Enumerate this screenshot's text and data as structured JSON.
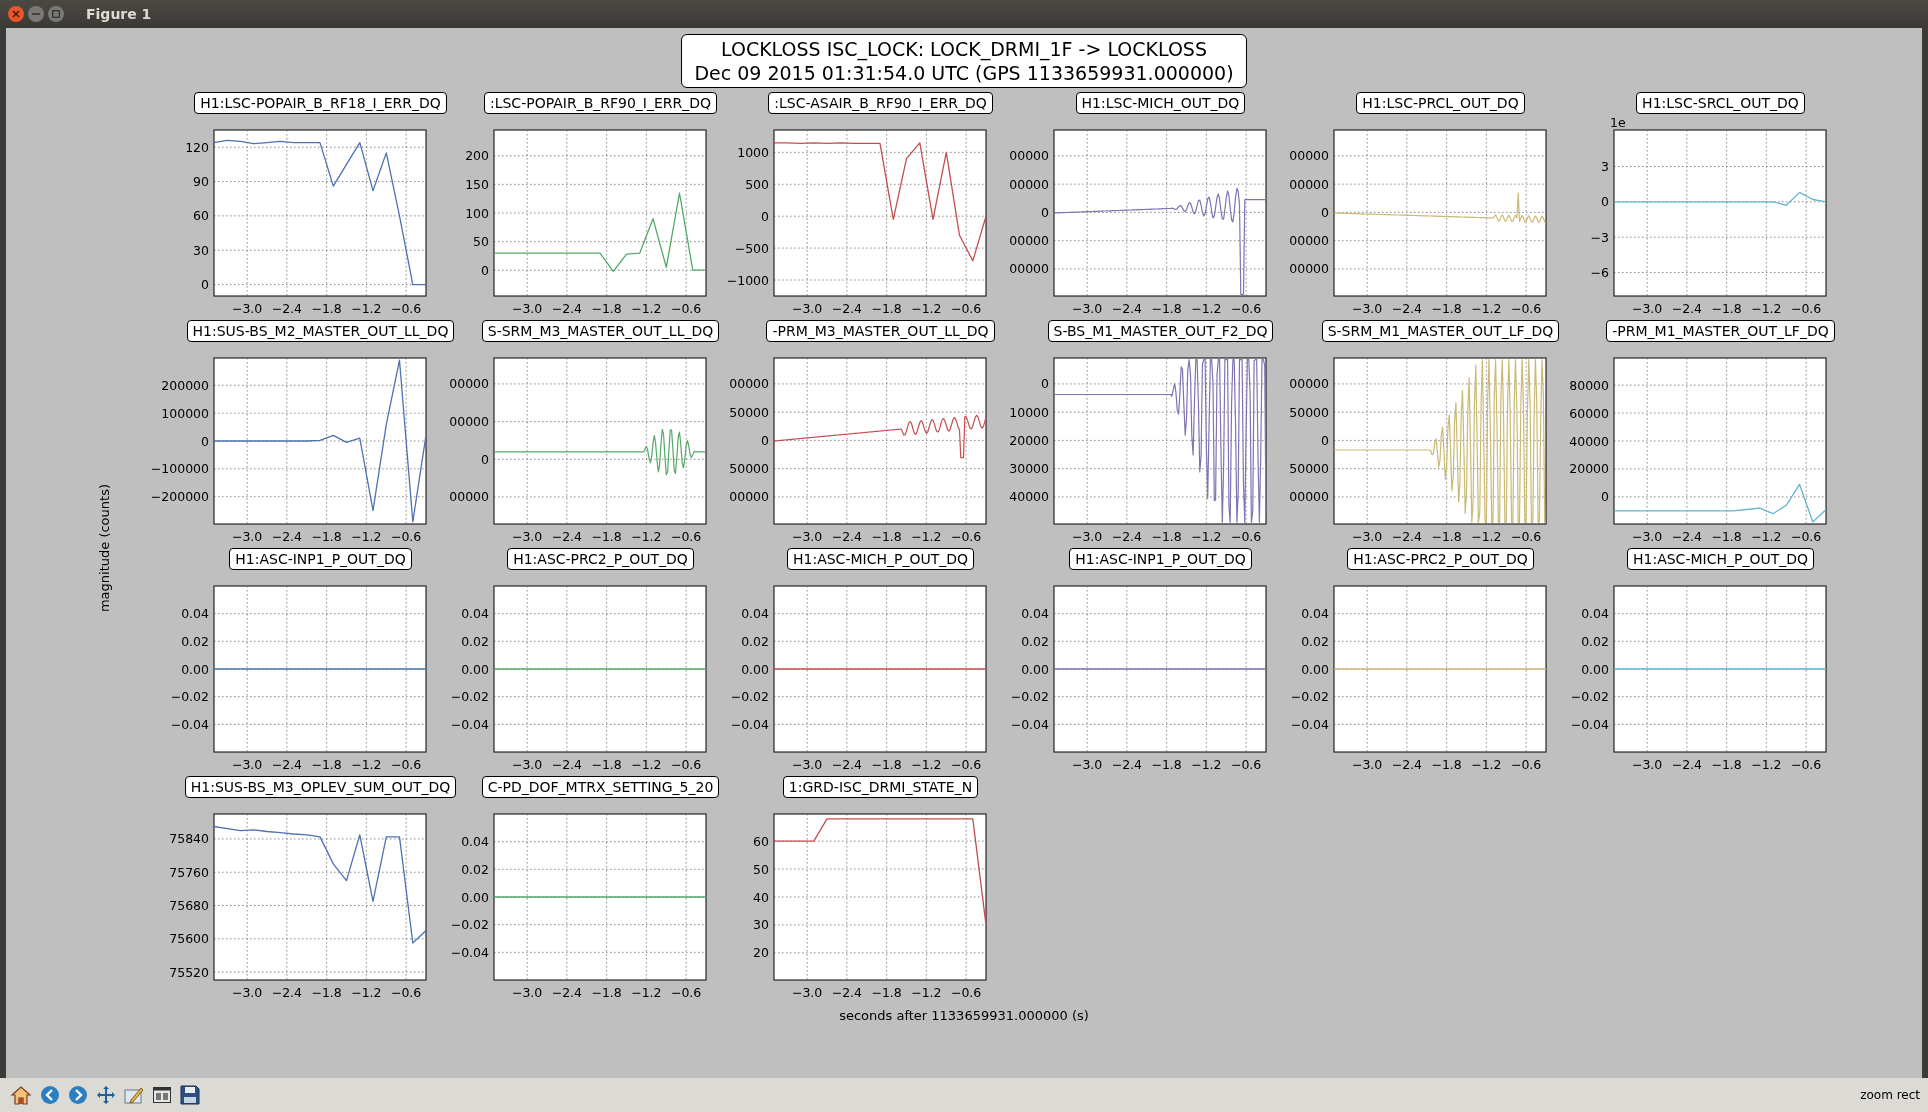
{
  "window": {
    "title": "Figure 1"
  },
  "figure": {
    "title": "LOCKLOSS ISC_LOCK: LOCK_DRMI_1F -> LOCKLOSS",
    "subtitle": "Dec 09 2015 01:31:54.0 UTC (GPS 1133659931.000000)",
    "ylabel": "magnitude (counts)",
    "xlabel": "seconds after 1133659931.000000 (s)",
    "panels": [
      {
        "chart_data": {
          "type": "line",
          "grid": true,
          "title": "H1:LSC-POPAIR_B_RF18_I_ERR_DQ",
          "x": [
            -3.5,
            -3.3,
            -3.1,
            -2.9,
            -2.7,
            -2.5,
            -2.3,
            -2.1,
            -1.9,
            -1.7,
            -1.5,
            -1.3,
            -1.1,
            -0.9,
            -0.7,
            -0.5,
            -0.3
          ],
          "xlim": [
            -3.5,
            -0.3
          ],
          "ylim": [
            -10,
            135
          ],
          "xticks": [
            {
              "value": -3,
              "label": "−3.0"
            },
            {
              "value": -2.4,
              "label": "−2.4"
            },
            {
              "value": -1.8,
              "label": "−1.8"
            },
            {
              "value": -1.2,
              "label": "−1.2"
            },
            {
              "value": -0.6,
              "label": "−0.6"
            }
          ],
          "yticks": [
            {
              "value": 0,
              "label": "0"
            },
            {
              "value": 30,
              "label": "30"
            },
            {
              "value": 60,
              "label": "60"
            },
            {
              "value": 90,
              "label": "90"
            },
            {
              "value": 120,
              "label": "120"
            }
          ],
          "series": [
            {
              "color": "#4c72b0",
              "values": [
                124,
                126,
                125,
                123,
                124,
                125,
                124,
                124,
                124,
                86,
                105,
                124,
                82,
                115,
                60,
                0,
                0
              ]
            }
          ]
        }
      },
      {
        "chart_data": {
          "type": "line",
          "grid": true,
          "title": ":LSC-POPAIR_B_RF90_I_ERR_DQ",
          "x": [
            -3.5,
            -3.3,
            -3.1,
            -2.9,
            -2.7,
            -2.5,
            -2.3,
            -2.1,
            -1.9,
            -1.7,
            -1.5,
            -1.3,
            -1.1,
            -0.9,
            -0.7,
            -0.5,
            -0.3
          ],
          "xlim": [
            -3.5,
            -0.3
          ],
          "ylim": [
            -45,
            245
          ],
          "xticks": [
            {
              "value": -3,
              "label": "−3.0"
            },
            {
              "value": -2.4,
              "label": "−2.4"
            },
            {
              "value": -1.8,
              "label": "−1.8"
            },
            {
              "value": -1.2,
              "label": "−1.2"
            },
            {
              "value": -0.6,
              "label": "−0.6"
            }
          ],
          "yticks": [
            {
              "value": 0,
              "label": "0"
            },
            {
              "value": 50,
              "label": "50"
            },
            {
              "value": 100,
              "label": "100"
            },
            {
              "value": 150,
              "label": "150"
            },
            {
              "value": 200,
              "label": "200"
            }
          ],
          "series": [
            {
              "color": "#55a868",
              "values": [
                30,
                30,
                30,
                30,
                30,
                30,
                30,
                30,
                30,
                -2,
                28,
                30,
                90,
                5,
                135,
                0,
                0
              ]
            }
          ]
        }
      },
      {
        "chart_data": {
          "type": "line",
          "grid": true,
          "title": ":LSC-ASAIR_B_RF90_I_ERR_DQ",
          "x": [
            -3.5,
            -3.3,
            -3.1,
            -2.9,
            -2.7,
            -2.5,
            -2.3,
            -2.1,
            -1.9,
            -1.7,
            -1.5,
            -1.3,
            -1.1,
            -0.9,
            -0.7,
            -0.5,
            -0.3
          ],
          "xlim": [
            -3.5,
            -0.3
          ],
          "ylim": [
            -1250,
            1350
          ],
          "xticks": [
            {
              "value": -3,
              "label": "−3.0"
            },
            {
              "value": -2.4,
              "label": "−2.4"
            },
            {
              "value": -1.8,
              "label": "−1.8"
            },
            {
              "value": -1.2,
              "label": "−1.2"
            },
            {
              "value": -0.6,
              "label": "−0.6"
            }
          ],
          "yticks": [
            {
              "value": -1000,
              "label": "−1000"
            },
            {
              "value": -500,
              "label": "−500"
            },
            {
              "value": 0,
              "label": "0"
            },
            {
              "value": 500,
              "label": "500"
            },
            {
              "value": 1000,
              "label": "1000"
            }
          ],
          "series": [
            {
              "color": "#c44e52",
              "values": [
                1150,
                1150,
                1140,
                1150,
                1140,
                1150,
                1140,
                1140,
                1140,
                -50,
                900,
                1150,
                -50,
                1000,
                -300,
                -700,
                0
              ]
            }
          ]
        }
      },
      {
        "title": "H1:LSC-MICH_OUT_DQ",
        "trace": {
          "kind": "drift-burst",
          "color": "#8172b2"
        },
        "ytick_labels": [
          "00000",
          "00000",
          "0",
          "00000",
          "00000"
        ],
        "xtick_labels": [
          "−3.0",
          "−2.4",
          "−1.8",
          "−1.2",
          "−0.6"
        ]
      },
      {
        "title": "H1:LSC-PRCL_OUT_DQ",
        "trace": {
          "kind": "flat-spike",
          "color": "#ccb974"
        },
        "ytick_labels": [
          "00000",
          "00000",
          "0",
          "00000",
          "00000"
        ],
        "xtick_labels": [
          "−3.0",
          "−2.4",
          "−1.8",
          "−1.2",
          "−0.6"
        ]
      },
      {
        "offset_label": "1e",
        "chart_data": {
          "type": "line",
          "grid": true,
          "title": "H1:LSC-SRCL_OUT_DQ",
          "x": [
            -3.5,
            -3.3,
            -3.1,
            -2.9,
            -2.7,
            -2.5,
            -2.3,
            -2.1,
            -1.9,
            -1.7,
            -1.5,
            -1.3,
            -1.1,
            -0.9,
            -0.7,
            -0.5,
            -0.3
          ],
          "xlim": [
            -3.5,
            -0.3
          ],
          "ylim": [
            -8,
            6.1
          ],
          "xticks": [
            {
              "value": -3,
              "label": "−3.0"
            },
            {
              "value": -2.4,
              "label": "−2.4"
            },
            {
              "value": -1.8,
              "label": "−1.8"
            },
            {
              "value": -1.2,
              "label": "−1.2"
            },
            {
              "value": -0.6,
              "label": "−0.6"
            }
          ],
          "yticks": [
            {
              "value": -6,
              "label": "−6"
            },
            {
              "value": -3,
              "label": "−3"
            },
            {
              "value": 0,
              "label": "0"
            },
            {
              "value": 3,
              "label": "3"
            }
          ],
          "series": [
            {
              "color": "#64b5cd",
              "values": [
                0,
                0,
                0,
                0,
                0,
                0,
                0,
                0,
                0,
                0,
                0,
                0,
                0,
                -0.3,
                0.8,
                0.2,
                0
              ]
            }
          ]
        }
      },
      {
        "chart_data": {
          "type": "line",
          "grid": true,
          "title": "H1:SUS-BS_M2_MASTER_OUT_LL_DQ",
          "x": [
            -3.5,
            -3.3,
            -3.1,
            -2.9,
            -2.7,
            -2.5,
            -2.3,
            -2.1,
            -1.9,
            -1.7,
            -1.5,
            -1.3,
            -1.1,
            -0.9,
            -0.7,
            -0.5,
            -0.3
          ],
          "xlim": [
            -3.5,
            -0.3
          ],
          "ylim": [
            -298000,
            298000
          ],
          "xticks": [
            {
              "value": -3,
              "label": "−3.0"
            },
            {
              "value": -2.4,
              "label": "−2.4"
            },
            {
              "value": -1.8,
              "label": "−1.8"
            },
            {
              "value": -1.2,
              "label": "−1.2"
            },
            {
              "value": -0.6,
              "label": "−0.6"
            }
          ],
          "yticks": [
            {
              "value": -200000,
              "label": "−200000"
            },
            {
              "value": -100000,
              "label": "−100000"
            },
            {
              "value": 0,
              "label": "0"
            },
            {
              "value": 100000,
              "label": "100000"
            },
            {
              "value": 200000,
              "label": "200000"
            }
          ],
          "series": [
            {
              "color": "#4c72b0",
              "values": [
                0,
                0,
                0,
                0,
                0,
                0,
                0,
                0,
                2000,
                20000,
                -5000,
                10000,
                -250000,
                60000,
                290000,
                -290000,
                20000
              ]
            }
          ]
        }
      },
      {
        "title": "S-SRM_M3_MASTER_OUT_LL_DQ",
        "trace": {
          "kind": "small-burst",
          "color": "#55a868"
        },
        "ytick_labels": [
          "00000",
          "00000",
          "0",
          "00000"
        ],
        "xtick_labels": [
          "−3.0",
          "−2.4",
          "−1.8",
          "−1.2",
          "−0.6"
        ]
      },
      {
        "title": "-PRM_M3_MASTER_OUT_LL_DQ",
        "trace": {
          "kind": "ramp",
          "color": "#c44e52"
        },
        "ytick_labels": [
          "00000",
          "50000",
          "0",
          "50000",
          "00000"
        ],
        "xtick_labels": [
          "−3.0",
          "−2.4",
          "−1.8",
          "−1.2",
          "−0.6"
        ]
      },
      {
        "title": "S-BS_M1_MASTER_OUT_F2_DQ",
        "trace": {
          "kind": "ring",
          "color": "#8172b2"
        },
        "ytick_labels": [
          "0",
          "10000",
          "20000",
          "30000",
          "40000"
        ],
        "xtick_labels": [
          "−3.0",
          "−2.4",
          "−1.8",
          "−1.2",
          "−0.6"
        ]
      },
      {
        "title": "S-SRM_M1_MASTER_OUT_LF_DQ",
        "trace": {
          "kind": "wide-ring",
          "color": "#ccb974"
        },
        "ytick_labels": [
          "00000",
          "50000",
          "0",
          "50000",
          "00000"
        ],
        "xtick_labels": [
          "−3.0",
          "−2.4",
          "−1.8",
          "−1.2",
          "−0.6"
        ]
      },
      {
        "chart_data": {
          "type": "line",
          "grid": true,
          "title": "-PRM_M1_MASTER_OUT_LF_DQ",
          "x": [
            -3.5,
            -3.3,
            -3.1,
            -2.9,
            -2.7,
            -2.5,
            -2.3,
            -2.1,
            -1.9,
            -1.7,
            -1.5,
            -1.3,
            -1.1,
            -0.9,
            -0.7,
            -0.5,
            -0.3
          ],
          "xlim": [
            -3.5,
            -0.3
          ],
          "ylim": [
            -19400,
            99400
          ],
          "xticks": [
            {
              "value": -3,
              "label": "−3.0"
            },
            {
              "value": -2.4,
              "label": "−2.4"
            },
            {
              "value": -1.8,
              "label": "−1.8"
            },
            {
              "value": -1.2,
              "label": "−1.2"
            },
            {
              "value": -0.6,
              "label": "−0.6"
            }
          ],
          "yticks": [
            {
              "value": 0,
              "label": "0"
            },
            {
              "value": 20000,
              "label": "20000"
            },
            {
              "value": 40000,
              "label": "40000"
            },
            {
              "value": 60000,
              "label": "60000"
            },
            {
              "value": 80000,
              "label": "80000"
            }
          ],
          "series": [
            {
              "color": "#64b5cd",
              "values": [
                -10000,
                -10000,
                -10000,
                -10000,
                -10000,
                -10000,
                -10000,
                -10000,
                -10000,
                -10000,
                -9000,
                -8000,
                -12000,
                -6000,
                9000,
                -18000,
                -9000
              ]
            }
          ]
        }
      },
      {
        "chart_data": {
          "type": "line",
          "grid": true,
          "title": "H1:ASC-INP1_P_OUT_DQ",
          "x": [
            -3.5,
            -3.3,
            -3.1,
            -2.9,
            -2.7,
            -2.5,
            -2.3,
            -2.1,
            -1.9,
            -1.7,
            -1.5,
            -1.3,
            -1.1,
            -0.9,
            -0.7,
            -0.5,
            -0.3
          ],
          "xlim": [
            -3.5,
            -0.3
          ],
          "ylim": [
            -0.06,
            0.06
          ],
          "xticks": [
            {
              "value": -3,
              "label": "−3.0"
            },
            {
              "value": -2.4,
              "label": "−2.4"
            },
            {
              "value": -1.8,
              "label": "−1.8"
            },
            {
              "value": -1.2,
              "label": "−1.2"
            },
            {
              "value": -0.6,
              "label": "−0.6"
            }
          ],
          "yticks": [
            {
              "value": -0.04,
              "label": "−0.04"
            },
            {
              "value": -0.02,
              "label": "−0.02"
            },
            {
              "value": 0,
              "label": "0.00"
            },
            {
              "value": 0.02,
              "label": "0.02"
            },
            {
              "value": 0.04,
              "label": "0.04"
            }
          ],
          "series": [
            {
              "color": "#4c72b0",
              "values": [
                0,
                0,
                0,
                0,
                0,
                0,
                0,
                0,
                0,
                0,
                0,
                0,
                0,
                0,
                0,
                0,
                0
              ]
            }
          ]
        }
      },
      {
        "chart_data": {
          "type": "line",
          "grid": true,
          "title": "H1:ASC-PRC2_P_OUT_DQ",
          "x": [
            -3.5,
            -3.3,
            -3.1,
            -2.9,
            -2.7,
            -2.5,
            -2.3,
            -2.1,
            -1.9,
            -1.7,
            -1.5,
            -1.3,
            -1.1,
            -0.9,
            -0.7,
            -0.5,
            -0.3
          ],
          "xlim": [
            -3.5,
            -0.3
          ],
          "ylim": [
            -0.06,
            0.06
          ],
          "xticks": [
            {
              "value": -3,
              "label": "−3.0"
            },
            {
              "value": -2.4,
              "label": "−2.4"
            },
            {
              "value": -1.8,
              "label": "−1.8"
            },
            {
              "value": -1.2,
              "label": "−1.2"
            },
            {
              "value": -0.6,
              "label": "−0.6"
            }
          ],
          "yticks": [
            {
              "value": -0.04,
              "label": "−0.04"
            },
            {
              "value": -0.02,
              "label": "−0.02"
            },
            {
              "value": 0,
              "label": "0.00"
            },
            {
              "value": 0.02,
              "label": "0.02"
            },
            {
              "value": 0.04,
              "label": "0.04"
            }
          ],
          "series": [
            {
              "color": "#55a868",
              "values": [
                0,
                0,
                0,
                0,
                0,
                0,
                0,
                0,
                0,
                0,
                0,
                0,
                0,
                0,
                0,
                0,
                0
              ]
            }
          ]
        }
      },
      {
        "chart_data": {
          "type": "line",
          "grid": true,
          "title": "H1:ASC-MICH_P_OUT_DQ",
          "x": [
            -3.5,
            -3.3,
            -3.1,
            -2.9,
            -2.7,
            -2.5,
            -2.3,
            -2.1,
            -1.9,
            -1.7,
            -1.5,
            -1.3,
            -1.1,
            -0.9,
            -0.7,
            -0.5,
            -0.3
          ],
          "xlim": [
            -3.5,
            -0.3
          ],
          "ylim": [
            -0.06,
            0.06
          ],
          "xticks": [
            {
              "value": -3,
              "label": "−3.0"
            },
            {
              "value": -2.4,
              "label": "−2.4"
            },
            {
              "value": -1.8,
              "label": "−1.8"
            },
            {
              "value": -1.2,
              "label": "−1.2"
            },
            {
              "value": -0.6,
              "label": "−0.6"
            }
          ],
          "yticks": [
            {
              "value": -0.04,
              "label": "−0.04"
            },
            {
              "value": -0.02,
              "label": "−0.02"
            },
            {
              "value": 0,
              "label": "0.00"
            },
            {
              "value": 0.02,
              "label": "0.02"
            },
            {
              "value": 0.04,
              "label": "0.04"
            }
          ],
          "series": [
            {
              "color": "#c44e52",
              "values": [
                0,
                0,
                0,
                0,
                0,
                0,
                0,
                0,
                0,
                0,
                0,
                0,
                0,
                0,
                0,
                0,
                0
              ]
            }
          ]
        }
      },
      {
        "chart_data": {
          "type": "line",
          "grid": true,
          "title": "H1:ASC-INP1_P_OUT_DQ",
          "x": [
            -3.5,
            -3.3,
            -3.1,
            -2.9,
            -2.7,
            -2.5,
            -2.3,
            -2.1,
            -1.9,
            -1.7,
            -1.5,
            -1.3,
            -1.1,
            -0.9,
            -0.7,
            -0.5,
            -0.3
          ],
          "xlim": [
            -3.5,
            -0.3
          ],
          "ylim": [
            -0.06,
            0.06
          ],
          "xticks": [
            {
              "value": -3,
              "label": "−3.0"
            },
            {
              "value": -2.4,
              "label": "−2.4"
            },
            {
              "value": -1.8,
              "label": "−1.8"
            },
            {
              "value": -1.2,
              "label": "−1.2"
            },
            {
              "value": -0.6,
              "label": "−0.6"
            }
          ],
          "yticks": [
            {
              "value": -0.04,
              "label": "−0.04"
            },
            {
              "value": -0.02,
              "label": "−0.02"
            },
            {
              "value": 0,
              "label": "0.00"
            },
            {
              "value": 0.02,
              "label": "0.02"
            },
            {
              "value": 0.04,
              "label": "0.04"
            }
          ],
          "series": [
            {
              "color": "#8172b2",
              "values": [
                0,
                0,
                0,
                0,
                0,
                0,
                0,
                0,
                0,
                0,
                0,
                0,
                0,
                0,
                0,
                0,
                0
              ]
            }
          ]
        }
      },
      {
        "chart_data": {
          "type": "line",
          "grid": true,
          "title": "H1:ASC-PRC2_P_OUT_DQ",
          "x": [
            -3.5,
            -3.3,
            -3.1,
            -2.9,
            -2.7,
            -2.5,
            -2.3,
            -2.1,
            -1.9,
            -1.7,
            -1.5,
            -1.3,
            -1.1,
            -0.9,
            -0.7,
            -0.5,
            -0.3
          ],
          "xlim": [
            -3.5,
            -0.3
          ],
          "ylim": [
            -0.06,
            0.06
          ],
          "xticks": [
            {
              "value": -3,
              "label": "−3.0"
            },
            {
              "value": -2.4,
              "label": "−2.4"
            },
            {
              "value": -1.8,
              "label": "−1.8"
            },
            {
              "value": -1.2,
              "label": "−1.2"
            },
            {
              "value": -0.6,
              "label": "−0.6"
            }
          ],
          "yticks": [
            {
              "value": -0.04,
              "label": "−0.04"
            },
            {
              "value": -0.02,
              "label": "−0.02"
            },
            {
              "value": 0,
              "label": "0.00"
            },
            {
              "value": 0.02,
              "label": "0.02"
            },
            {
              "value": 0.04,
              "label": "0.04"
            }
          ],
          "series": [
            {
              "color": "#ccb974",
              "values": [
                0,
                0,
                0,
                0,
                0,
                0,
                0,
                0,
                0,
                0,
                0,
                0,
                0,
                0,
                0,
                0,
                0
              ]
            }
          ]
        }
      },
      {
        "chart_data": {
          "type": "line",
          "grid": true,
          "title": "H1:ASC-MICH_P_OUT_DQ",
          "x": [
            -3.5,
            -3.3,
            -3.1,
            -2.9,
            -2.7,
            -2.5,
            -2.3,
            -2.1,
            -1.9,
            -1.7,
            -1.5,
            -1.3,
            -1.1,
            -0.9,
            -0.7,
            -0.5,
            -0.3
          ],
          "xlim": [
            -3.5,
            -0.3
          ],
          "ylim": [
            -0.06,
            0.06
          ],
          "xticks": [
            {
              "value": -3,
              "label": "−3.0"
            },
            {
              "value": -2.4,
              "label": "−2.4"
            },
            {
              "value": -1.8,
              "label": "−1.8"
            },
            {
              "value": -1.2,
              "label": "−1.2"
            },
            {
              "value": -0.6,
              "label": "−0.6"
            }
          ],
          "yticks": [
            {
              "value": -0.04,
              "label": "−0.04"
            },
            {
              "value": -0.02,
              "label": "−0.02"
            },
            {
              "value": 0,
              "label": "0.00"
            },
            {
              "value": 0.02,
              "label": "0.02"
            },
            {
              "value": 0.04,
              "label": "0.04"
            }
          ],
          "series": [
            {
              "color": "#64b5cd",
              "values": [
                0,
                0,
                0,
                0,
                0,
                0,
                0,
                0,
                0,
                0,
                0,
                0,
                0,
                0,
                0,
                0,
                0
              ]
            }
          ]
        }
      },
      {
        "chart_data": {
          "type": "line",
          "grid": true,
          "title": "H1:SUS-BS_M3_OPLEV_SUM_OUT_DQ",
          "x": [
            -3.5,
            -3.3,
            -3.1,
            -2.9,
            -2.7,
            -2.5,
            -2.3,
            -2.1,
            -1.9,
            -1.7,
            -1.5,
            -1.3,
            -1.1,
            -0.9,
            -0.7,
            -0.5,
            -0.3
          ],
          "xlim": [
            -3.5,
            -0.3
          ],
          "ylim": [
            75501,
            75900
          ],
          "xticks": [
            {
              "value": -3,
              "label": "−3.0"
            },
            {
              "value": -2.4,
              "label": "−2.4"
            },
            {
              "value": -1.8,
              "label": "−1.8"
            },
            {
              "value": -1.2,
              "label": "−1.2"
            },
            {
              "value": -0.6,
              "label": "−0.6"
            }
          ],
          "yticks": [
            {
              "value": 75520,
              "label": "75520"
            },
            {
              "value": 75600,
              "label": "75600"
            },
            {
              "value": 75680,
              "label": "75680"
            },
            {
              "value": 75760,
              "label": "75760"
            },
            {
              "value": 75840,
              "label": "75840"
            }
          ],
          "series": [
            {
              "color": "#4c72b0",
              "values": [
                75870,
                75865,
                75860,
                75862,
                75858,
                75855,
                75852,
                75850,
                75845,
                75780,
                75740,
                75850,
                75690,
                75845,
                75845,
                75590,
                75620
              ]
            }
          ]
        }
      },
      {
        "chart_data": {
          "type": "line",
          "grid": true,
          "title": "C-PD_DOF_MTRX_SETTING_5_20",
          "x": [
            -3.5,
            -3.3,
            -3.1,
            -2.9,
            -2.7,
            -2.5,
            -2.3,
            -2.1,
            -1.9,
            -1.7,
            -1.5,
            -1.3,
            -1.1,
            -0.9,
            -0.7,
            -0.5,
            -0.3
          ],
          "xlim": [
            -3.5,
            -0.3
          ],
          "ylim": [
            -0.06,
            0.06
          ],
          "xticks": [
            {
              "value": -3,
              "label": "−3.0"
            },
            {
              "value": -2.4,
              "label": "−2.4"
            },
            {
              "value": -1.8,
              "label": "−1.8"
            },
            {
              "value": -1.2,
              "label": "−1.2"
            },
            {
              "value": -0.6,
              "label": "−0.6"
            }
          ],
          "yticks": [
            {
              "value": -0.04,
              "label": "−0.04"
            },
            {
              "value": -0.02,
              "label": "−0.02"
            },
            {
              "value": 0,
              "label": "0.00"
            },
            {
              "value": 0.02,
              "label": "0.02"
            },
            {
              "value": 0.04,
              "label": "0.04"
            }
          ],
          "series": [
            {
              "color": "#55a868",
              "values": [
                0,
                0,
                0,
                0,
                0,
                0,
                0,
                0,
                0,
                0,
                0,
                0,
                0,
                0,
                0,
                0,
                0
              ]
            }
          ]
        }
      },
      {
        "chart_data": {
          "type": "line",
          "grid": true,
          "title": "1:GRD-ISC_DRMI_STATE_N",
          "x": [
            -3.5,
            -3.3,
            -3.1,
            -2.9,
            -2.7,
            -2.5,
            -2.3,
            -2.1,
            -1.9,
            -1.7,
            -1.5,
            -1.3,
            -1.1,
            -0.9,
            -0.7,
            -0.5,
            -0.3
          ],
          "xlim": [
            -3.5,
            -0.3
          ],
          "ylim": [
            10.3,
            69.7
          ],
          "xticks": [
            {
              "value": -3,
              "label": "−3.0"
            },
            {
              "value": -2.4,
              "label": "−2.4"
            },
            {
              "value": -1.8,
              "label": "−1.8"
            },
            {
              "value": -1.2,
              "label": "−1.2"
            },
            {
              "value": -0.6,
              "label": "−0.6"
            }
          ],
          "yticks": [
            {
              "value": 20,
              "label": "20"
            },
            {
              "value": 30,
              "label": "30"
            },
            {
              "value": 40,
              "label": "40"
            },
            {
              "value": 50,
              "label": "50"
            },
            {
              "value": 60,
              "label": "60"
            }
          ],
          "series": [
            {
              "color": "#c44e52",
              "values": [
                60,
                60,
                60,
                60,
                68,
                68,
                68,
                68,
                68,
                68,
                68,
                68,
                68,
                68,
                68,
                68,
                30
              ]
            }
          ]
        }
      }
    ]
  },
  "status_bar": {
    "message": "zoom rect"
  }
}
